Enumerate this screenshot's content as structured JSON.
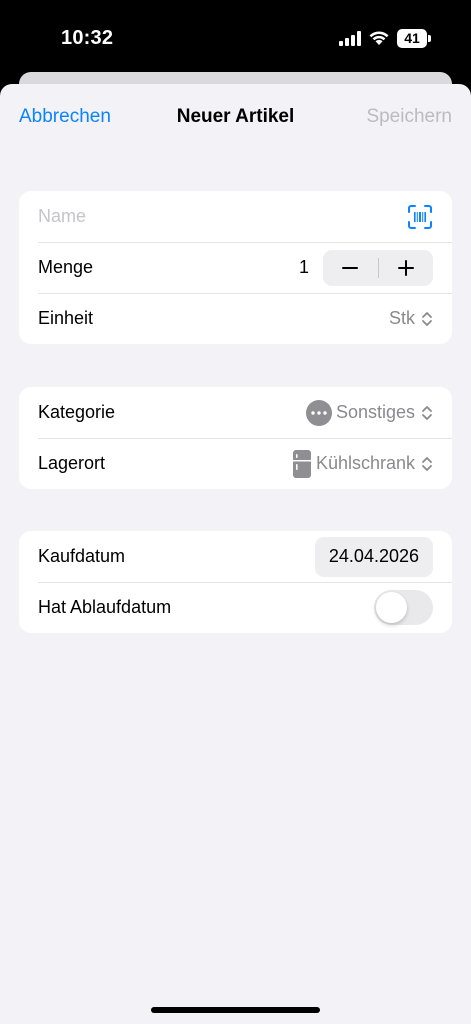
{
  "status_bar": {
    "time": "10:32",
    "battery": "41"
  },
  "nav": {
    "cancel_label": "Abbrechen",
    "title": "Neuer Artikel",
    "save_label": "Speichern"
  },
  "details": {
    "name_placeholder": "Name",
    "name_value": "",
    "quantity_label": "Menge",
    "quantity_value": "1",
    "unit_label": "Einheit",
    "unit_value": "Stk"
  },
  "classification": {
    "category_label": "Kategorie",
    "category_value": "Sonstiges",
    "location_label": "Lagerort",
    "location_value": "Kühlschrank"
  },
  "dates": {
    "purchase_label": "Kaufdatum",
    "purchase_value": "24.04.2026",
    "expiry_label": "Hat Ablaufdatum",
    "expiry_enabled": false
  },
  "colors": {
    "accent": "#0a84ff",
    "disabled": "#bcbcc0",
    "secondary_text": "#8a8a8e",
    "background": "#f2f2f7"
  },
  "icons": [
    "signal-icon",
    "wifi-icon",
    "battery-icon",
    "barcode-scan-icon",
    "minus-icon",
    "plus-icon",
    "chevron-updown-icon",
    "more-icon",
    "fridge-icon"
  ]
}
